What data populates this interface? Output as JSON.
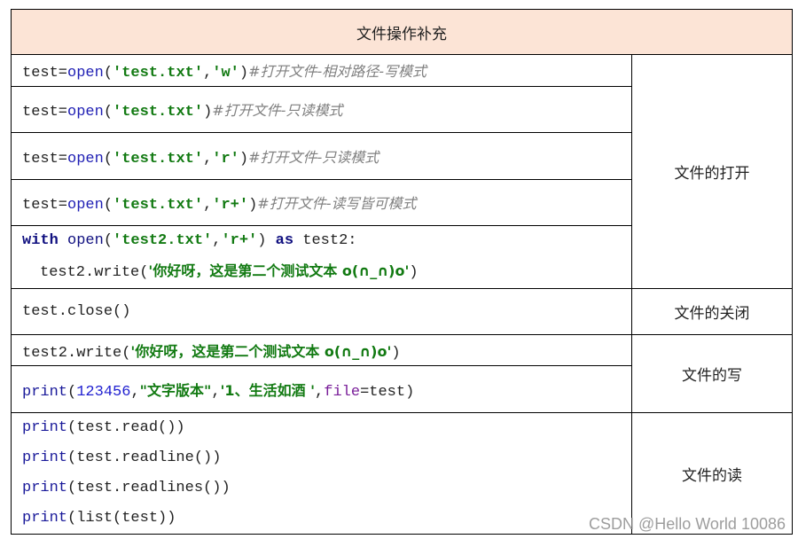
{
  "title": "文件操作补充",
  "categories": {
    "open": "文件的打开",
    "close": "文件的关闭",
    "write": "文件的写",
    "read": "文件的读"
  },
  "rows": {
    "open_w": {
      "var": "test=",
      "fn": "open",
      "lp": "(",
      "arg1": "'test.txt'",
      "comma": ",",
      "arg2": "'w'",
      "rp": ")",
      "comment": "#打开文件-相对路径-写模式"
    },
    "open_default": {
      "var": "test=",
      "fn": "open",
      "lp": "(",
      "arg1": "'test.txt'",
      "rp": ")",
      "comment": "#打开文件-只读模式"
    },
    "open_r": {
      "var": "test=",
      "fn": "open",
      "lp": "(",
      "arg1": "'test.txt'",
      "comma": ",",
      "arg2": "'r'",
      "rp": ")",
      "comment": "#打开文件-只读模式"
    },
    "open_rplus": {
      "var": "test=",
      "fn": "open",
      "lp": "(",
      "arg1": "'test.txt'",
      "comma": ",",
      "arg2": "'r+'",
      "rp": ")",
      "comment": "#打开文件-读写皆可模式"
    },
    "with_block": {
      "kw_with": "with",
      "fn": " open",
      "lp": "(",
      "arg1": "'test2.txt'",
      "comma": ",",
      "arg2": "'r+'",
      "rp": ") ",
      "kw_as": "as",
      "target": " test2:",
      "body_call": "test2.write(",
      "body_str": "'你好呀，这是第二个测试文本 o(∩_∩)o'",
      "body_end": ")"
    },
    "close": {
      "code": "test.close()"
    },
    "write": {
      "call": "test2.write(",
      "str": "'你好呀，这是第二个测试文本 o(∩_∩)o'",
      "end": ")"
    },
    "print_file": {
      "fn": "print",
      "lp": "(",
      "num": "123456",
      "c1": ",",
      "str1": "\"文字版本\"",
      "c2": ",",
      "str2": "'1、生活如酒 '",
      "c3": ",",
      "param": "file",
      "rest": "=test)"
    },
    "read_lines": [
      {
        "fn": "print",
        "rest": "(test.read())"
      },
      {
        "fn": "print",
        "rest": "(test.readline())"
      },
      {
        "fn": "print",
        "rest": "(test.readlines())"
      },
      {
        "fn": "print",
        "rest": "(list(test))"
      }
    ]
  },
  "watermark": "CSDN @Hello World 10086"
}
